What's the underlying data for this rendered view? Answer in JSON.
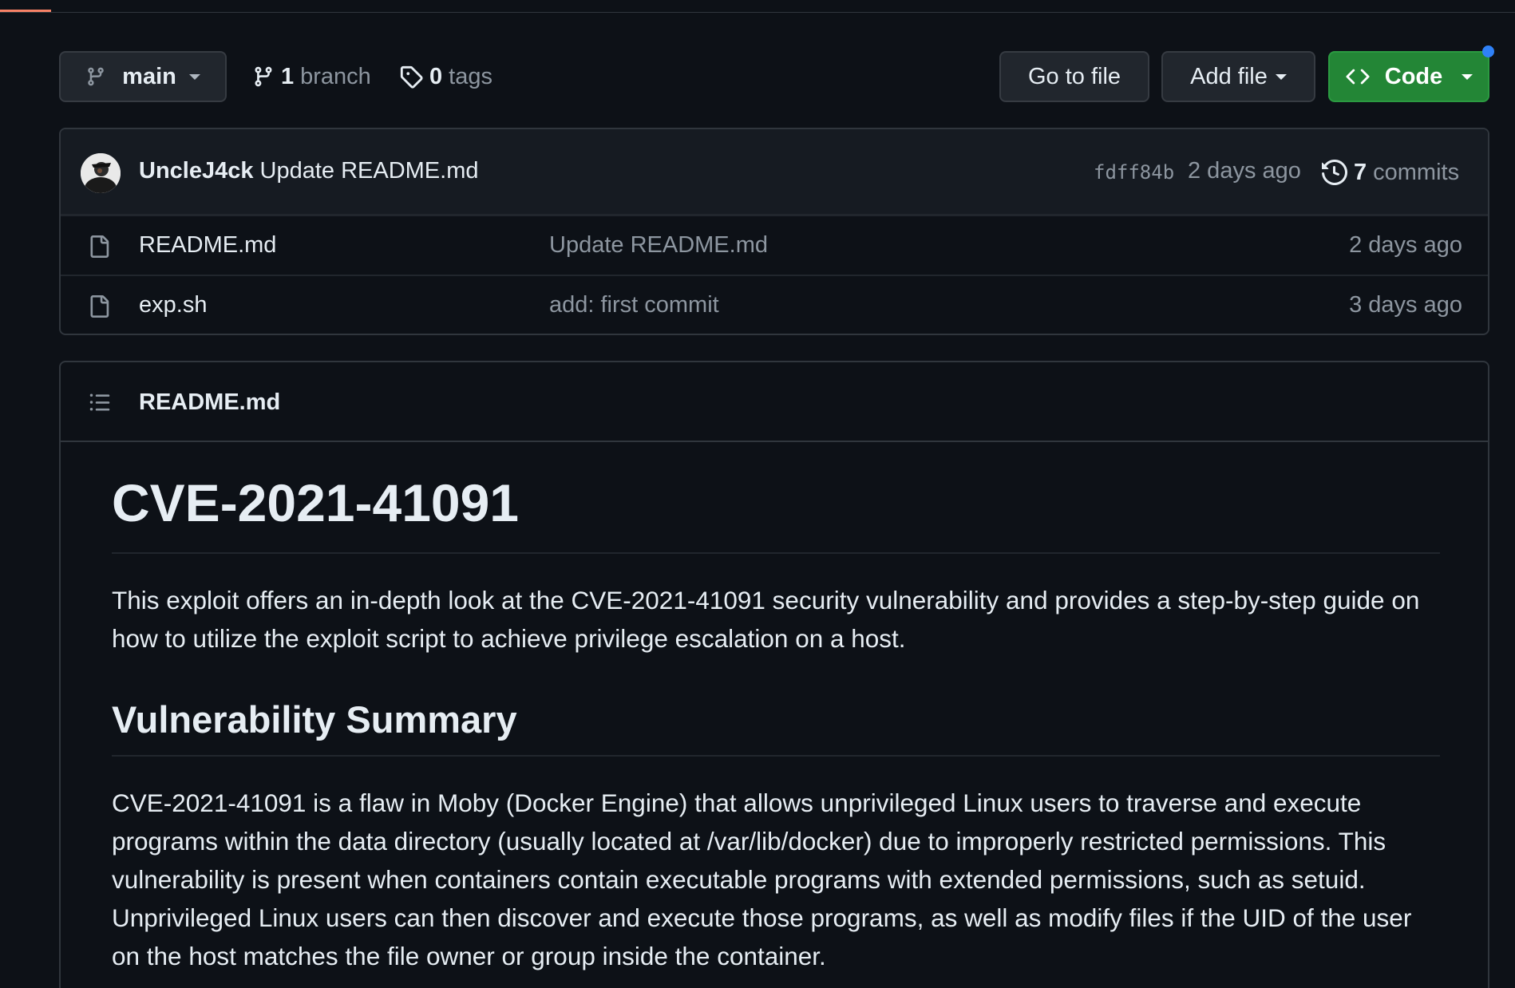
{
  "toolbar": {
    "branch_name": "main",
    "branch_count": "1",
    "branch_label": "branch",
    "tag_count": "0",
    "tag_label": "tags",
    "go_to_file": "Go to file",
    "add_file": "Add file",
    "code": "Code"
  },
  "commit": {
    "author": "UncleJ4ck",
    "message": "Update README.md",
    "sha": "fdff84b",
    "age": "2 days ago",
    "commit_count": "7",
    "commit_label": "commits"
  },
  "files": [
    {
      "name": "README.md",
      "message": "Update README.md",
      "age": "2 days ago",
      "icon": "file-icon"
    },
    {
      "name": "exp.sh",
      "message": "add: first commit",
      "age": "3 days ago",
      "icon": "file-icon"
    }
  ],
  "readme": {
    "header_title": "README.md",
    "title": "CVE-2021-41091",
    "intro": "This exploit offers an in-depth look at the CVE-2021-41091 security vulnerability and provides a step-by-step guide on how to utilize the exploit script to achieve privilege escalation on a host.",
    "section_title": "Vulnerability Summary",
    "summary": "CVE-2021-41091 is a flaw in Moby (Docker Engine) that allows unprivileged Linux users to traverse and execute programs within the data directory (usually located at /var/lib/docker) due to improperly restricted permissions. This vulnerability is present when containers contain executable programs with extended permissions, such as setuid. Unprivileged Linux users can then discover and execute those programs, as well as modify files if the UID of the user on the host matches the file owner or group inside the container."
  },
  "colors": {
    "background": "#0d1117",
    "code_button": "#238636",
    "notification": "#2f81f7",
    "accent_underline": "#f78166"
  }
}
